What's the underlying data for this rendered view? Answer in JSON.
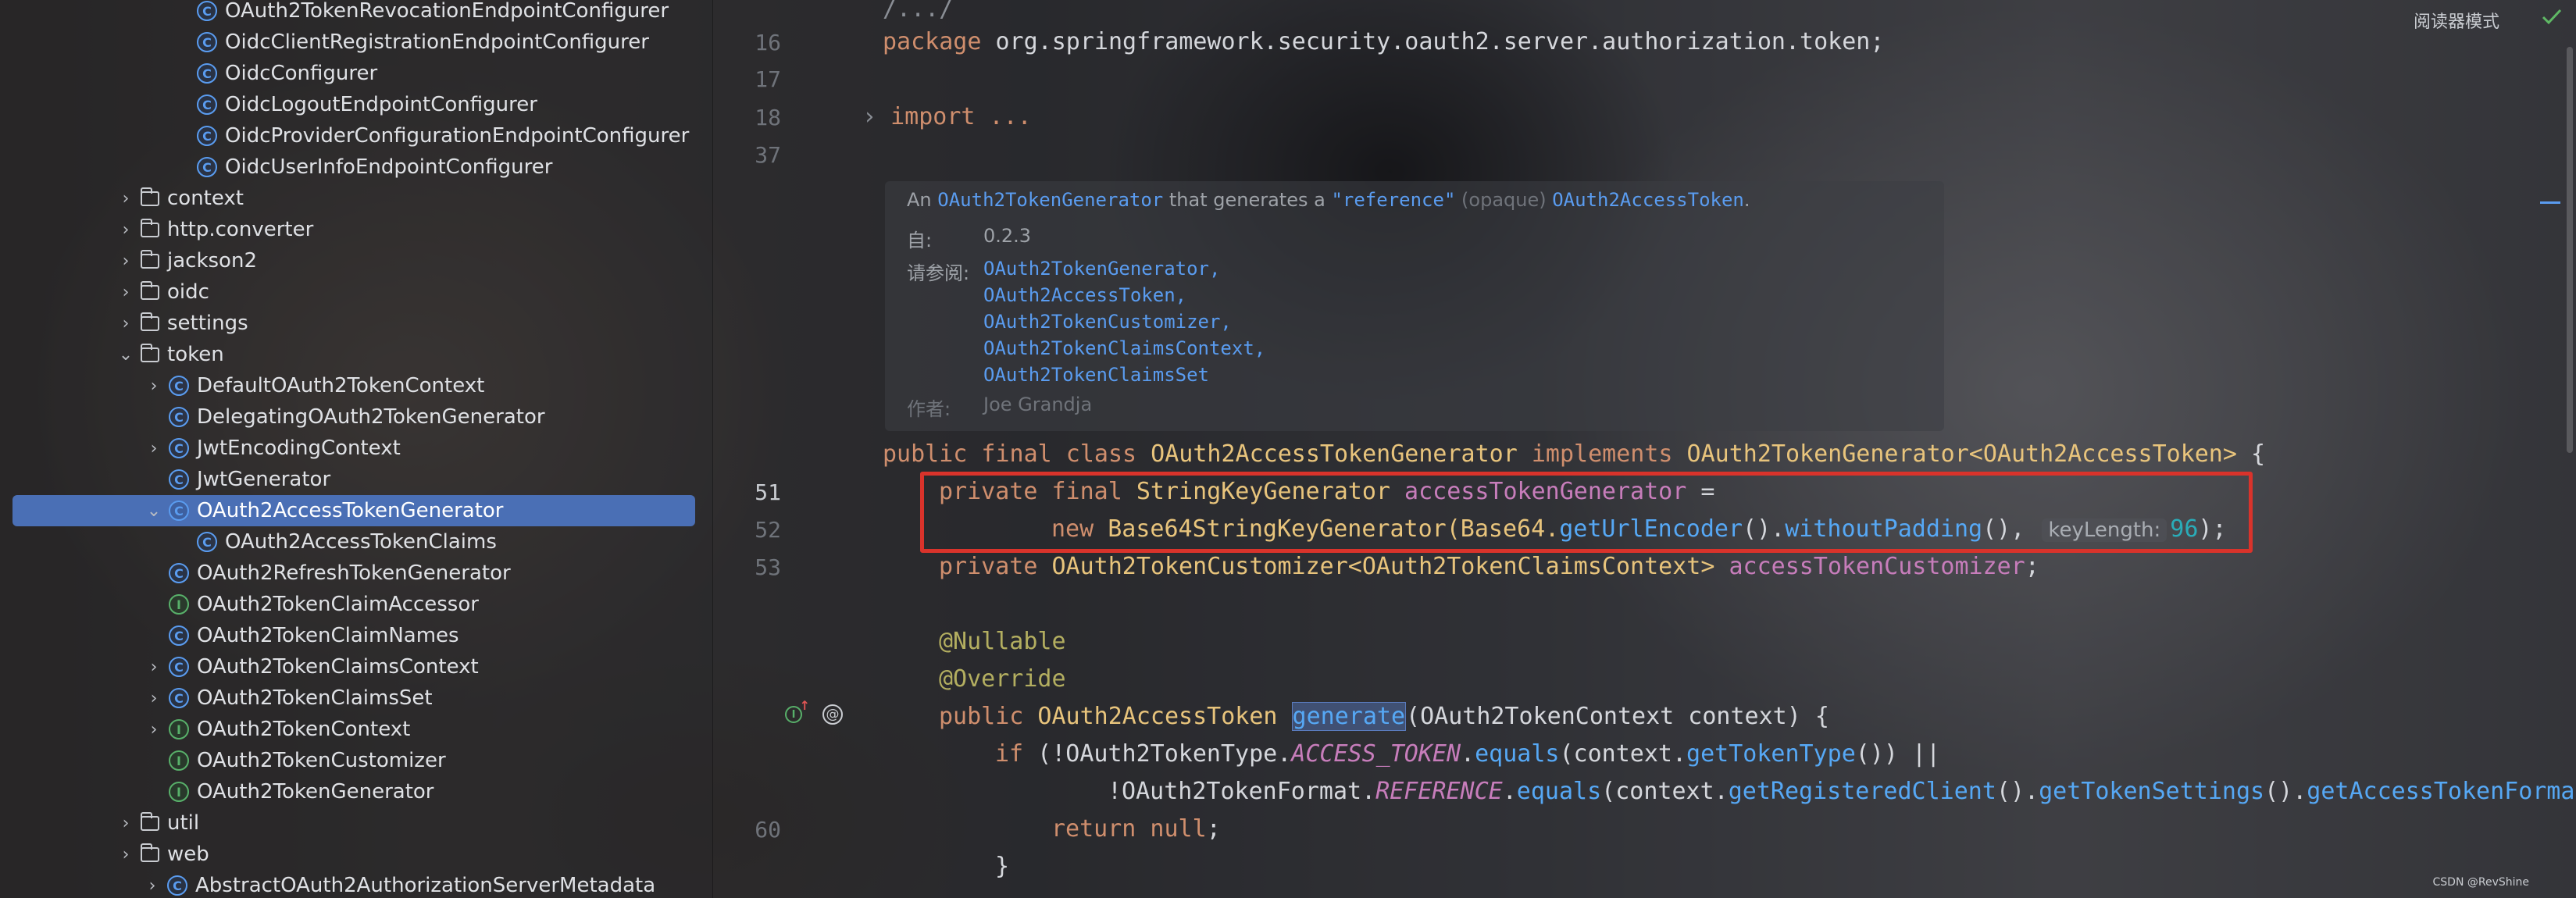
{
  "tree": {
    "items": [
      {
        "label": "OAuth2TokenRevocationEndpointConfigurer",
        "type": "class",
        "expand": "none",
        "indent": 2
      },
      {
        "label": "OidcClientRegistrationEndpointConfigurer",
        "type": "class",
        "expand": "none",
        "indent": 2
      },
      {
        "label": "OidcConfigurer",
        "type": "class",
        "expand": "none",
        "indent": 2
      },
      {
        "label": "OidcLogoutEndpointConfigurer",
        "type": "class",
        "expand": "none",
        "indent": 2
      },
      {
        "label": "OidcProviderConfigurationEndpointConfigurer",
        "type": "class",
        "expand": "none",
        "indent": 2
      },
      {
        "label": "OidcUserInfoEndpointConfigurer",
        "type": "class",
        "expand": "none",
        "indent": 2
      },
      {
        "label": "context",
        "type": "folder",
        "expand": "collapsed",
        "indent": 0
      },
      {
        "label": "http.converter",
        "type": "folder",
        "expand": "collapsed",
        "indent": 0
      },
      {
        "label": "jackson2",
        "type": "folder",
        "expand": "collapsed",
        "indent": 0
      },
      {
        "label": "oidc",
        "type": "folder",
        "expand": "collapsed",
        "indent": 0
      },
      {
        "label": "settings",
        "type": "folder",
        "expand": "collapsed",
        "indent": 0
      },
      {
        "label": "token",
        "type": "folder",
        "expand": "expanded",
        "indent": 0
      },
      {
        "label": "DefaultOAuth2TokenContext",
        "type": "class",
        "expand": "collapsed",
        "indent": 1
      },
      {
        "label": "DelegatingOAuth2TokenGenerator",
        "type": "class",
        "expand": "none",
        "indent": 1
      },
      {
        "label": "JwtEncodingContext",
        "type": "class",
        "expand": "collapsed",
        "indent": 1
      },
      {
        "label": "JwtGenerator",
        "type": "class",
        "expand": "none",
        "indent": 1
      },
      {
        "label": "OAuth2AccessTokenGenerator",
        "type": "class",
        "expand": "expanded",
        "indent": 1,
        "selected": true
      },
      {
        "label": "OAuth2AccessTokenClaims",
        "type": "class",
        "expand": "none",
        "indent": 2
      },
      {
        "label": "OAuth2RefreshTokenGenerator",
        "type": "class",
        "expand": "none",
        "indent": 1
      },
      {
        "label": "OAuth2TokenClaimAccessor",
        "type": "interface",
        "expand": "none",
        "indent": 1
      },
      {
        "label": "OAuth2TokenClaimNames",
        "type": "class",
        "expand": "none",
        "indent": 1
      },
      {
        "label": "OAuth2TokenClaimsContext",
        "type": "class",
        "expand": "collapsed",
        "indent": 1
      },
      {
        "label": "OAuth2TokenClaimsSet",
        "type": "class",
        "expand": "collapsed",
        "indent": 1
      },
      {
        "label": "OAuth2TokenContext",
        "type": "interface",
        "expand": "collapsed",
        "indent": 1
      },
      {
        "label": "OAuth2TokenCustomizer",
        "type": "interface",
        "expand": "none",
        "indent": 1
      },
      {
        "label": "OAuth2TokenGenerator",
        "type": "interface",
        "expand": "none",
        "indent": 1
      },
      {
        "label": "util",
        "type": "folder",
        "expand": "collapsed",
        "indent": 0
      },
      {
        "label": "web",
        "type": "folder",
        "expand": "collapsed",
        "indent": 0
      },
      {
        "label": "AbstractOAuth2AuthorizationServerMetadata",
        "type": "class",
        "expand": "collapsed",
        "indent": 0
      }
    ],
    "class_glyph": "C",
    "interface_glyph": "I"
  },
  "editor": {
    "reader_mode": "阅读器模式",
    "gutter": [
      "16",
      "17",
      "18",
      "37",
      "51",
      "52",
      "53",
      "60"
    ],
    "lines": {
      "l_top": "/.../",
      "l16_kw": "package",
      "l16_pkg": " org.springframework.security.oauth2.server.authorization.token;",
      "l18_kw": "import",
      "l18_rest": " ...",
      "l50_a": "public final class",
      "l50_b": " OAuth2AccessTokenGenerator ",
      "l50_c": "implements",
      "l50_d": " OAuth2TokenGenerator",
      "l50_e": "<OAuth2AccessToken>",
      "l50_f": " {",
      "l51_a": "private final",
      "l51_b": " StringKeyGenerator ",
      "l51_c": "accessTokenGenerator",
      "l51_d": " =",
      "l52_a": "new",
      "l52_b": " Base64StringKeyGenerator(Base64.",
      "l52_c": "getUrlEncoder",
      "l52_d": "().",
      "l52_e": "withoutPadding",
      "l52_f": "(), ",
      "l52_hint": "keyLength:",
      "l52_num": "96",
      "l52_g": ");",
      "l53_a": "private",
      "l53_b": " OAuth2TokenCustomizer<OAuth2TokenClaimsContext> ",
      "l53_c": "accessTokenCustomizer",
      "l53_d": ";",
      "ann1": "@Nullable",
      "ann2": "@Override",
      "gen_a": "public",
      "gen_b": " OAuth2AccessToken ",
      "gen_c": "generate",
      "gen_d": "(OAuth2TokenContext context) {",
      "if_a": "if",
      "if_b": " (!OAuth2TokenType.",
      "if_c": "ACCESS_TOKEN",
      "if_d": ".",
      "if_e": "equals",
      "if_f": "(context.",
      "if_g": "getTokenType",
      "if_h": "()) ||",
      "or_a": "!OAuth2TokenFormat.",
      "or_b": "REFERENCE",
      "or_c": ".",
      "or_d": "equals",
      "or_e": "(context.",
      "or_f": "getRegisteredClient",
      "or_g": "().",
      "or_h": "getTokenSettings",
      "or_i": "().",
      "or_j": "getAccessTokenFormat",
      "ret_a": "return",
      "ret_b": " null",
      "ret_c": ";",
      "close": "}"
    },
    "doc": {
      "intro_a": "An ",
      "intro_link1": "OAuth2TokenGenerator",
      "intro_b": " that generates a ",
      "intro_q": "\"reference\"",
      "intro_c": " (opaque) ",
      "intro_link2": "OAuth2AccessToken",
      "intro_d": ".",
      "since_key": "自:",
      "since_val": "0.2.3",
      "see_key": "请参阅:",
      "see": [
        "OAuth2TokenGenerator,",
        "OAuth2AccessToken,",
        "OAuth2TokenCustomizer,",
        "OAuth2TokenClaimsContext,",
        "OAuth2TokenClaimsSet"
      ],
      "author_key": "作者:",
      "author_val": "Joe Grandja"
    },
    "watermark": "CSDN @RevShine"
  },
  "colors": {
    "selection": "#4a6fb5",
    "highlight_box": "#d9332b",
    "link": "#5a9cf0"
  }
}
